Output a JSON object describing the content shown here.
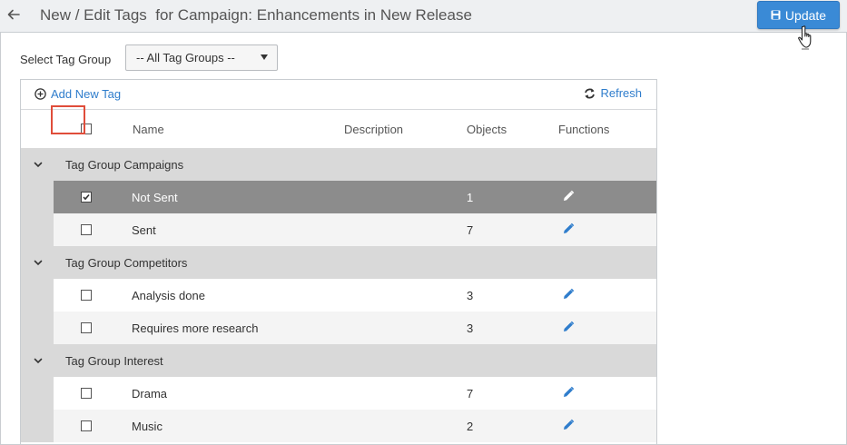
{
  "header": {
    "title": "New / Edit Tags  for Campaign: Enhancements in New Release",
    "update_label": "Update"
  },
  "filter": {
    "label": "Select Tag Group",
    "selected": "-- All Tag Groups --"
  },
  "toolbar": {
    "add_label": "Add New Tag",
    "refresh_label": "Refresh"
  },
  "columns": {
    "name": "Name",
    "description": "Description",
    "objects": "Objects",
    "functions": "Functions"
  },
  "groups": [
    {
      "name": "Tag Group Campaigns",
      "tags": [
        {
          "name": "Not Sent",
          "objects": "1",
          "checked": true,
          "selected": true
        },
        {
          "name": "Sent",
          "objects": "7",
          "checked": false,
          "selected": false
        }
      ]
    },
    {
      "name": "Tag Group Competitors",
      "tags": [
        {
          "name": "Analysis done",
          "objects": "3",
          "checked": false,
          "selected": false
        },
        {
          "name": "Requires more research",
          "objects": "3",
          "checked": false,
          "selected": false
        }
      ]
    },
    {
      "name": "Tag Group Interest",
      "tags": [
        {
          "name": "Drama",
          "objects": "7",
          "checked": false,
          "selected": false
        },
        {
          "name": "Music",
          "objects": "2",
          "checked": false,
          "selected": false
        }
      ]
    }
  ],
  "colors": {
    "accent": "#3a8ad6",
    "link": "#2f7dcc",
    "selected_row": "#8c8c8c",
    "group_row": "#d9d9d9",
    "highlight": "#e04d3a"
  }
}
